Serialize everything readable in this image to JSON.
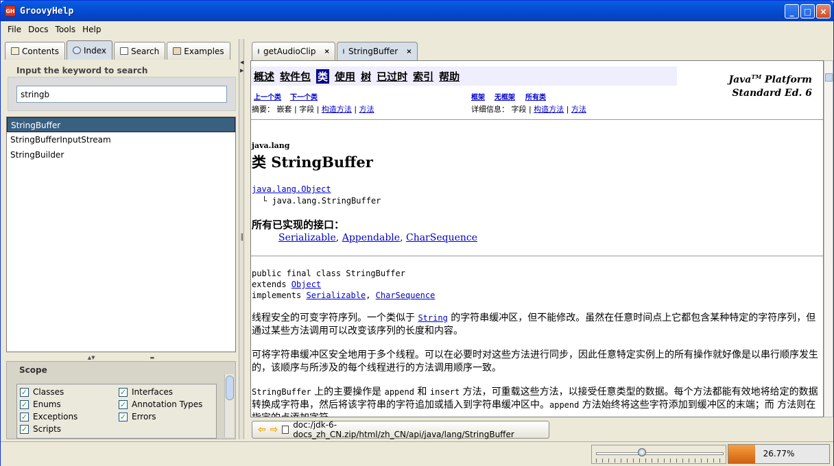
{
  "window": {
    "title": "GroovyHelp",
    "app_icon_text": "GH"
  },
  "menu": [
    "File",
    "Docs",
    "Tools",
    "Help"
  ],
  "left_tabs": [
    {
      "label": "Contents",
      "icon": "book-icon"
    },
    {
      "label": "Index",
      "icon": "magnifier-icon",
      "active": true
    },
    {
      "label": "Search",
      "icon": "search-page-icon"
    },
    {
      "label": "Examples",
      "icon": "examples-icon"
    }
  ],
  "index": {
    "label": "Input the keyword to search",
    "value": "stringb",
    "results": [
      "StringBuffer",
      "StringBufferInputStream",
      "StringBuilder"
    ],
    "selected": 0
  },
  "scope": {
    "title": "Scope",
    "items": [
      {
        "label": "Classes",
        "checked": true
      },
      {
        "label": "Interfaces",
        "checked": true
      },
      {
        "label": "Enums",
        "checked": true
      },
      {
        "label": "Annotation Types",
        "checked": true
      },
      {
        "label": "Exceptions",
        "checked": true
      },
      {
        "label": "Errors",
        "checked": true
      },
      {
        "label": "Scripts",
        "checked": true
      }
    ]
  },
  "doc_tabs": [
    {
      "label": "getAudioClip",
      "close": "×"
    },
    {
      "label": "StringBuffer",
      "close": "×",
      "active": true
    }
  ],
  "doc": {
    "nav": [
      "概述",
      "软件包",
      "类",
      "使用",
      "树",
      "已过时",
      "索引",
      "帮助"
    ],
    "nav_selected": 2,
    "platform_line1": "Java",
    "platform_tm": "TM",
    "platform_line1b": " Platform",
    "platform_line2": "Standard Ed. 6",
    "prev_class": "上一个类",
    "next_class": "下一个类",
    "frames": "框架",
    "no_frames": "无框架",
    "all_classes": "所有类",
    "summary_prefix": "摘要：",
    "summary_nested": "嵌套",
    "summary_field": "字段",
    "summary_ctor": "构造方法",
    "summary_method": "方法",
    "detail_prefix": "详细信息：",
    "detail_field": "字段",
    "detail_ctor": "构造方法",
    "detail_method": "方法",
    "package": "java.lang",
    "class_heading": "类 StringBuffer",
    "parent_link": "java.lang.Object",
    "child_class": "java.lang.StringBuffer",
    "interfaces_heading": "所有已实现的接口：",
    "interfaces": [
      "Serializable",
      "Appendable",
      "CharSequence"
    ],
    "decl_line1": "public final class StringBuffer",
    "decl_extends": "extends ",
    "decl_object": "Object",
    "decl_implements": "implements ",
    "decl_serializable": "Serializable",
    "decl_charseq": "CharSequence",
    "para1_a": "线程安全的可变字符序列。一个类似于 ",
    "para1_link": "String",
    "para1_b": " 的字符串缓冲区，但不能修改。虽然在任意时间点上它都包含某种特定的字符序列，但通过某些方法调用可以改变该序列的长度和内容。",
    "para2": "可将字符串缓冲区安全地用于多个线程。可以在必要时对这些方法进行同步，因此任意特定实例上的所有操作就好像是以串行顺序发生的，该顺序与所涉及的每个线程进行的方法调用顺序一致。",
    "para3_code1": "StringBuffer",
    "para3_a": " 上的主要操作是 ",
    "para3_code2": "append",
    "para3_b": " 和 ",
    "para3_code3": "insert",
    "para3_c": " 方法，可重载这些方法，以接受任意类型的数据。每个方法都能有效地将给定的数据转换成字符串，然后将该字符串的字符追加或插入到字符串缓冲区中。",
    "para3_code4": "append",
    "para3_d": " 方法始终将这些字符添加到缓冲区的末端；而 ",
    "para3_e": " 方法则在指定的点添加字符。"
  },
  "url": "doc:/jdk-6-docs_zh_CN.zip/html/zh_CN/api/java/lang/StringBuffer",
  "status": {
    "zoom_level": 0.35,
    "progress_text": "26.77%",
    "progress_value": 0.2677
  }
}
